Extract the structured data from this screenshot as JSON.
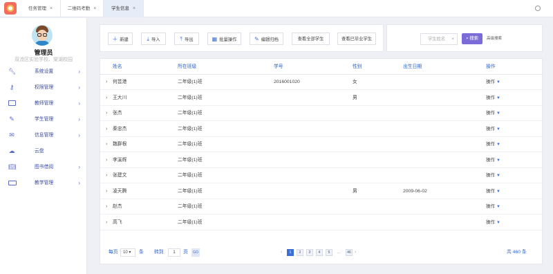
{
  "tabs": [
    {
      "label": "任务管理",
      "close": "×"
    },
    {
      "label": "二维码考勤",
      "close": "×"
    },
    {
      "label": "学生信息",
      "close": "×"
    }
  ],
  "user": {
    "name": "管理员",
    "school": "双流区实验学校、棠湖校园"
  },
  "menu": [
    {
      "label": "系统设置",
      "icon": "wrench-icon",
      "arrow": "›"
    },
    {
      "label": "权限管理",
      "icon": "key-icon",
      "arrow": "›"
    },
    {
      "label": "教师管理",
      "icon": "briefcase-icon",
      "arrow": "›"
    },
    {
      "label": "学生管理",
      "icon": "pencil-icon",
      "arrow": "›"
    },
    {
      "label": "信息管理",
      "icon": "mail-icon",
      "arrow": "›"
    },
    {
      "label": "云盘",
      "icon": "cloud-icon",
      "arrow": ""
    },
    {
      "label": "图书借阅",
      "icon": "book-icon",
      "arrow": "›"
    },
    {
      "label": "教学管理",
      "icon": "keyboard-icon",
      "arrow": "›"
    }
  ],
  "toolbar": {
    "new": "新建",
    "import": "导入",
    "export": "导出",
    "batch": "批量操作",
    "edit_qr": "编辑归档",
    "view_all": "查看全部学生",
    "view_graduated": "查看已毕业学生"
  },
  "search": {
    "placeholder": "学生姓名",
    "clear": "×",
    "button": "搜索",
    "advanced": "高级搜索"
  },
  "table": {
    "headers": {
      "name": "姓名",
      "class": "所在班级",
      "id": "学号",
      "gender": "性别",
      "birth": "出生日期",
      "op": "操作"
    },
    "op_label": "操作",
    "rows": [
      {
        "name": "何芸港",
        "class": "二年级(1)班",
        "id": "2016001020",
        "gender": "女",
        "birth": ""
      },
      {
        "name": "王大川",
        "class": "二年级(1)班",
        "id": "",
        "gender": "男",
        "birth": ""
      },
      {
        "name": "张杰",
        "class": "二年级(1)班",
        "id": "",
        "gender": "",
        "birth": ""
      },
      {
        "name": "秦忠杰",
        "class": "二年级(1)班",
        "id": "",
        "gender": "",
        "birth": ""
      },
      {
        "name": "魏群根",
        "class": "二年级(1)班",
        "id": "",
        "gender": "",
        "birth": ""
      },
      {
        "name": "李溪辉",
        "class": "二年级(1)班",
        "id": "",
        "gender": "",
        "birth": ""
      },
      {
        "name": "张建文",
        "class": "二年级(1)班",
        "id": "",
        "gender": "",
        "birth": ""
      },
      {
        "name": "凌天腾",
        "class": "二年级(1)班",
        "id": "",
        "gender": "男",
        "birth": "2009-06-02"
      },
      {
        "name": "赵杰",
        "class": "二年级(1)班",
        "id": "",
        "gender": "",
        "birth": ""
      },
      {
        "name": "高飞",
        "class": "二年级(1)班",
        "id": "",
        "gender": "",
        "birth": ""
      }
    ]
  },
  "pager": {
    "per_page": "每页",
    "per_page_value": "10 ▾",
    "unit": "条",
    "goto": "转到",
    "goto_value": "1",
    "page": "页",
    "go": "GO",
    "pages": [
      "1",
      "2",
      "3",
      "4",
      "5"
    ],
    "dots": "…",
    "last": "46",
    "prev": "‹",
    "next": "›",
    "total": "共 460 条"
  }
}
